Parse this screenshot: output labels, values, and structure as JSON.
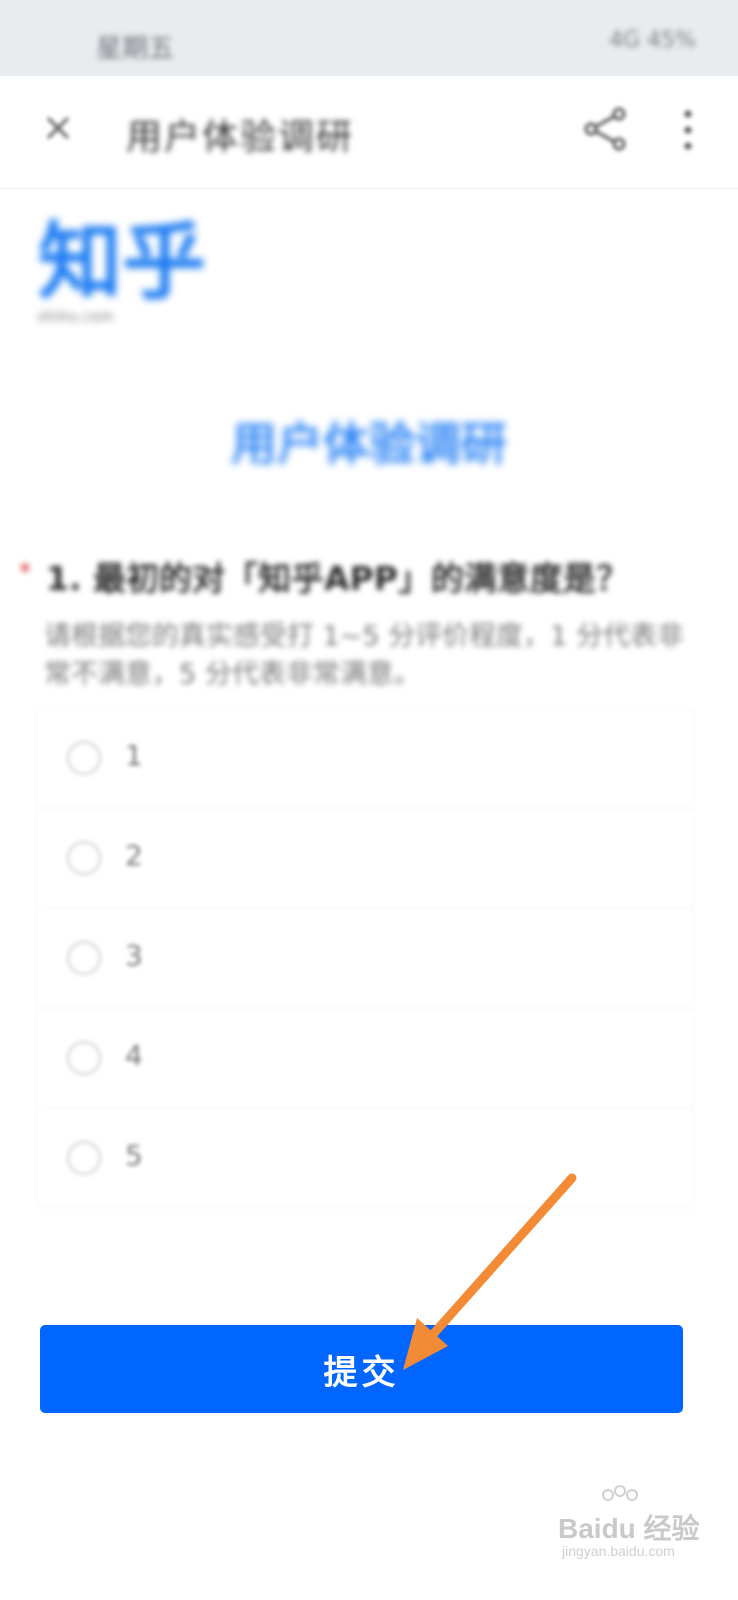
{
  "status_bar": {
    "left_text": "星期五",
    "right_text": "4G 45%"
  },
  "top_bar": {
    "title": "用户体验调研"
  },
  "logo": {
    "main": "知乎",
    "sub": "zhihu.com"
  },
  "survey": {
    "title": "用户体验调研",
    "required_mark": "*",
    "question": "1. 最初的对「知乎APP」的满意度是？",
    "description": "请根据您的真实感受打 1~5 分评价程度，1 分代表非常不满意，5 分代表非常满意。",
    "options": [
      {
        "label": "1"
      },
      {
        "label": "2"
      },
      {
        "label": "3"
      },
      {
        "label": "4"
      },
      {
        "label": "5"
      }
    ]
  },
  "submit_label": "提交",
  "annotation_color": "#f28a36",
  "primary_color": "#0066ff",
  "watermark": {
    "main": "Baidu 经验",
    "sub": "jingyan.baidu.com"
  }
}
